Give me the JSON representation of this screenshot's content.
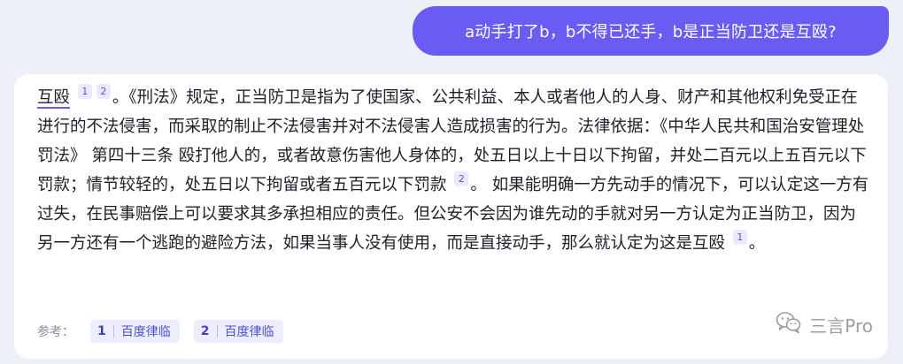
{
  "question": {
    "text": "a动手打了b，b不得已还手，b是正当防卫还是互殴?"
  },
  "answer": {
    "term": "互殴",
    "cite1": "1",
    "cite2": "2",
    "p1": "。《刑法》规定，正当防卫是指为了使国家、公共利益、本人或者他人的人身、财产和其他权利免受正在进行的不法侵害，而采取的制止不法侵害并对不法侵害人造成损害的行为。法律依据：《中华人民共和国治安管理处罚法》 第四十三条 殴打他人的，或者故意伤害他人身体的，处五日以上十日以下拘留，并处二百元以上五百元以下罚款；情节较轻的，处五日以下拘留或者五百元以下罚款",
    "cite3": "2",
    "p2": "。 如果能明确一方先动手的情况下，可以认定这一方有过失，在民事赔偿上可以要求其多承担相应的责任。但公安不会因为谁先动的手就对另一方认定为正当防卫，因为另一方还有一个逃跑的避险方法，如果当事人没有使用，而是直接动手，那么就认定为这是互殴",
    "cite4": "1",
    "p3": "。"
  },
  "references": {
    "label": "参考：",
    "items": [
      {
        "num": "1",
        "source": "百度律临"
      },
      {
        "num": "2",
        "source": "百度律临"
      }
    ]
  },
  "watermark": {
    "text": "三言Pro",
    "icon": "wechat-icon"
  },
  "colors": {
    "accent": "#6a5cf2",
    "background": "#eef0f8",
    "card": "#ffffff"
  }
}
